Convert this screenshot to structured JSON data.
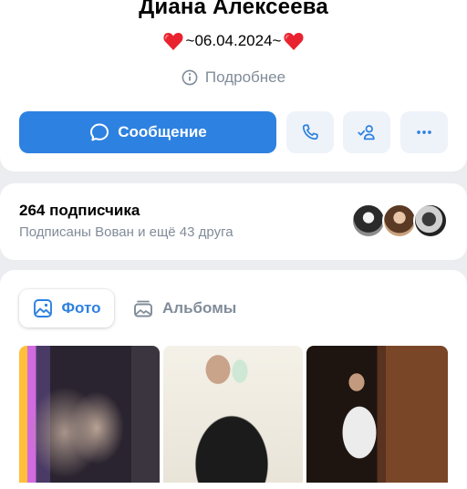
{
  "profile": {
    "name": "Диана Алексеева",
    "status_text": "~06.04.2024~",
    "more_info_label": "Подробнее"
  },
  "actions": {
    "message_label": "Сообщение",
    "call_icon": "phone-icon",
    "friend_icon": "friend-added-icon",
    "more_icon": "more-horizontal-icon"
  },
  "followers": {
    "count_label": "264 подписчика",
    "subtitle": "Подписаны Вован и ещё 43 друга"
  },
  "media_tabs": [
    {
      "label": "Фото",
      "icon": "photo-icon",
      "active": true
    },
    {
      "label": "Альбомы",
      "icon": "albums-icon",
      "active": false
    }
  ],
  "colors": {
    "accent": "#2d81e0",
    "secondary_text": "#818c99",
    "heart": "#e8232f",
    "page_background": "#ebedf0"
  }
}
